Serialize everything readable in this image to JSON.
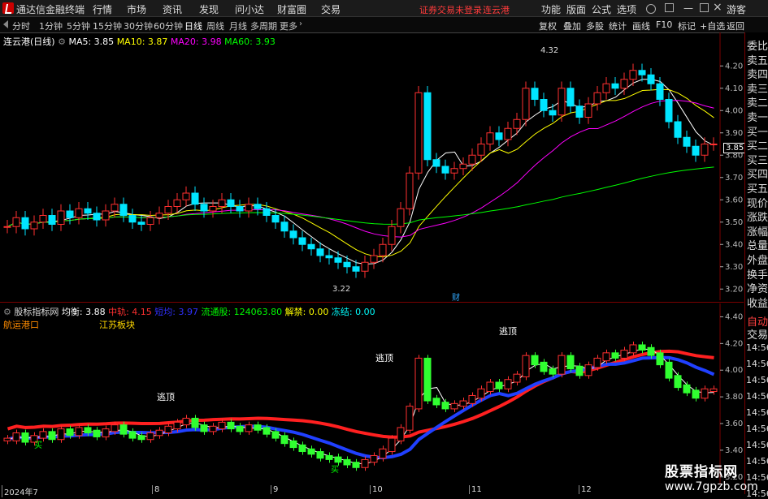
{
  "titlebar": {
    "app_name": "通达信金融终端",
    "menus": [
      "行情",
      "市场",
      "资讯",
      "发现",
      "问小达",
      "财富圈",
      "交易"
    ],
    "warning": "证券交易未登录",
    "stock": "连云港",
    "right": [
      "功能",
      "版面",
      "公式",
      "选项"
    ],
    "guest": "游客"
  },
  "toolbar": {
    "timeframes": [
      "分时",
      "1分钟",
      "5分钟",
      "15分钟",
      "30分钟",
      "60分钟",
      "日线",
      "周线",
      "月线",
      "多周期",
      "更多"
    ],
    "active_timeframe": "日线",
    "right_buttons": [
      "复权",
      "叠加",
      "多股",
      "统计",
      "画线",
      "F10",
      "标记",
      "+自选",
      "返回"
    ]
  },
  "main_chart": {
    "title": "连云港(日线)",
    "ma": [
      {
        "label": "MA5: 3.85",
        "color": "#ffffff"
      },
      {
        "label": "MA10: 3.87",
        "color": "#ffff00"
      },
      {
        "label": "MA20: 3.98",
        "color": "#ff00ff"
      },
      {
        "label": "MA60: 3.93",
        "color": "#00ff00"
      }
    ],
    "y_ticks": [
      "4.20",
      "4.10",
      "4.00",
      "3.90",
      "3.80",
      "3.70",
      "3.60",
      "3.50",
      "3.40",
      "3.30",
      "3.20"
    ],
    "high_label": "4.32",
    "low_label": "3.22",
    "fin_marker": "财",
    "current_price": "3.85"
  },
  "sub_chart": {
    "indicator_name": "股标指标网",
    "legend": [
      {
        "label": "均衡: 3.88",
        "color": "#ffffff"
      },
      {
        "label": "中轨: 4.15",
        "color": "#ff3030"
      },
      {
        "label": "短均: 3.97",
        "color": "#3030ff"
      },
      {
        "label": "流通股: 124063.80",
        "color": "#00ff00"
      },
      {
        "label": "解禁: 0.00",
        "color": "#ffff00"
      },
      {
        "label": "冻结: 0.00",
        "color": "#00ffff"
      }
    ],
    "sector1": "航运港口",
    "sector2": "江苏板块",
    "escape_label": "逃顶",
    "buy_label": "买",
    "y_ticks": [
      "4.40",
      "4.20",
      "4.00",
      "3.80",
      "3.60",
      "3.40",
      "3.20"
    ]
  },
  "right_panel": {
    "items": [
      "委比",
      "卖五",
      "卖四",
      "卖三",
      "卖二",
      "卖一",
      "买一",
      "买二",
      "买三",
      "买四",
      "买五",
      "现价",
      "涨跌",
      "涨幅",
      "总量",
      "外盘",
      "换手",
      "净资",
      "收益"
    ],
    "auto": "自动",
    "trade": "交易",
    "times": [
      "14:56",
      "14:56",
      "14:56",
      "14:56",
      "14:56",
      "14:56",
      "14:56",
      "14:56",
      "14:56",
      "14:56"
    ]
  },
  "date_axis": [
    "2024年7",
    "8",
    "9",
    "10",
    "11",
    "12"
  ],
  "watermark": {
    "line1": "股票指标网",
    "line2": "www.7gpzb.com"
  },
  "chart_data": {
    "type": "candlestick",
    "title": "连云港(日线)",
    "ylim": [
      3.15,
      4.35
    ],
    "closes": [
      3.48,
      3.52,
      3.47,
      3.5,
      3.53,
      3.49,
      3.55,
      3.52,
      3.56,
      3.54,
      3.51,
      3.55,
      3.58,
      3.53,
      3.5,
      3.49,
      3.52,
      3.54,
      3.57,
      3.6,
      3.63,
      3.58,
      3.55,
      3.57,
      3.6,
      3.57,
      3.55,
      3.58,
      3.56,
      3.53,
      3.5,
      3.46,
      3.43,
      3.4,
      3.38,
      3.35,
      3.34,
      3.32,
      3.3,
      3.28,
      3.32,
      3.35,
      3.4,
      3.48,
      3.56,
      3.72,
      4.08,
      3.78,
      3.75,
      3.72,
      3.74,
      3.76,
      3.8,
      3.85,
      3.9,
      3.87,
      3.92,
      3.96,
      4.1,
      4.05,
      4.0,
      3.98,
      4.1,
      4.02,
      3.97,
      4.03,
      4.08,
      4.12,
      4.1,
      4.14,
      4.18,
      4.16,
      4.12,
      4.05,
      3.95,
      3.88,
      3.84,
      3.8,
      3.85,
      3.85
    ]
  }
}
